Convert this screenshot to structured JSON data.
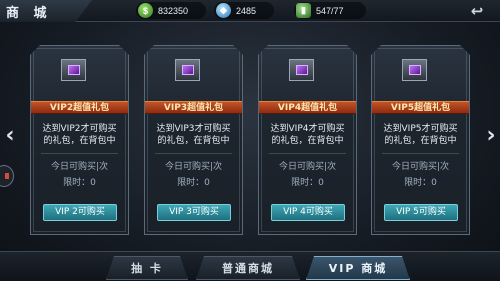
{
  "header": {
    "title": "商 城",
    "money": "832350",
    "gems": "2485",
    "stamina": "547/77",
    "back_icon": "back-arrow-icon"
  },
  "cards": [
    {
      "title": "VIP2超值礼包",
      "desc_line1": "达到VIP2才可购买",
      "desc_line2": "的礼包，在背包中",
      "today": "今日可购买",
      "today_unit": "次",
      "limit": "限时：",
      "limit_value": "0",
      "button": "VIP 2可购买"
    },
    {
      "title": "VIP3超值礼包",
      "desc_line1": "达到VIP3才可购买",
      "desc_line2": "的礼包，在背包中",
      "today": "今日可购买",
      "today_unit": "次",
      "limit": "限时：",
      "limit_value": "0",
      "button": "VIP 3可购买"
    },
    {
      "title": "VIP4超值礼包",
      "desc_line1": "达到VIP4才可购买",
      "desc_line2": "的礼包，在背包中",
      "today": "今日可购买",
      "today_unit": "次",
      "limit": "限时：",
      "limit_value": "0",
      "button": "VIP 4可购买"
    },
    {
      "title": "VIP5超值礼包",
      "desc_line1": "达到VIP5才可购买",
      "desc_line2": "的礼包，在背包中",
      "today": "今日可购买",
      "today_unit": "次",
      "limit": "限时：",
      "limit_value": "0",
      "button": "VIP 5可购买"
    }
  ],
  "tabs": {
    "draw": "抽 卡",
    "normal": "普通商城",
    "vip": "VIP 商城"
  },
  "colors": {
    "ribbon": "#c25424",
    "button": "#3fa7b6",
    "active_tab": "#3c556b"
  }
}
